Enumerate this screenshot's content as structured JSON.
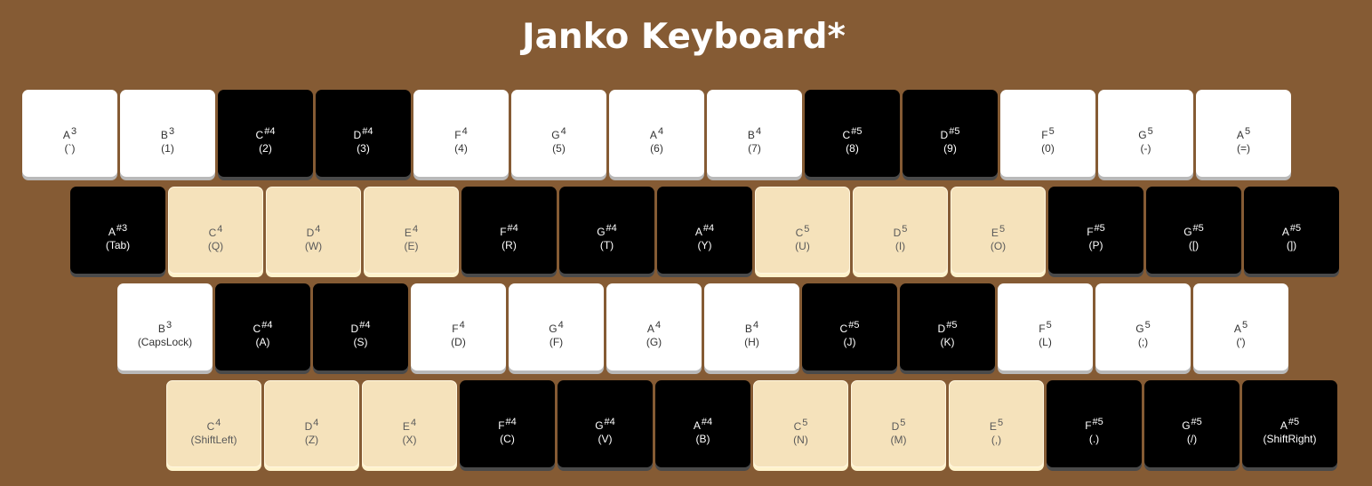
{
  "page": {
    "title": "Janko Keyboard*"
  },
  "colors": {
    "background": "#855b34",
    "white_key": "#ffffff",
    "black_key": "#000000",
    "cream_key": "#f5e2bb"
  },
  "rows": [
    {
      "keys": [
        {
          "note": "A",
          "octave": "3",
          "kb": "(`)",
          "color": "white"
        },
        {
          "note": "B",
          "octave": "3",
          "kb": "(1)",
          "color": "white"
        },
        {
          "note": "C",
          "octave": "#4",
          "kb": "(2)",
          "color": "black"
        },
        {
          "note": "D",
          "octave": "#4",
          "kb": "(3)",
          "color": "black"
        },
        {
          "note": "F",
          "octave": "4",
          "kb": "(4)",
          "color": "white"
        },
        {
          "note": "G",
          "octave": "4",
          "kb": "(5)",
          "color": "white"
        },
        {
          "note": "A",
          "octave": "4",
          "kb": "(6)",
          "color": "white"
        },
        {
          "note": "B",
          "octave": "4",
          "kb": "(7)",
          "color": "white"
        },
        {
          "note": "C",
          "octave": "#5",
          "kb": "(8)",
          "color": "black"
        },
        {
          "note": "D",
          "octave": "#5",
          "kb": "(9)",
          "color": "black"
        },
        {
          "note": "F",
          "octave": "5",
          "kb": "(0)",
          "color": "white"
        },
        {
          "note": "G",
          "octave": "5",
          "kb": "(-)",
          "color": "white"
        },
        {
          "note": "A",
          "octave": "5",
          "kb": "(=)",
          "color": "white"
        }
      ]
    },
    {
      "keys": [
        {
          "note": "A",
          "octave": "#3",
          "kb": "(Tab)",
          "color": "black"
        },
        {
          "note": "C",
          "octave": "4",
          "kb": "(Q)",
          "color": "cream"
        },
        {
          "note": "D",
          "octave": "4",
          "kb": "(W)",
          "color": "cream"
        },
        {
          "note": "E",
          "octave": "4",
          "kb": "(E)",
          "color": "cream"
        },
        {
          "note": "F",
          "octave": "#4",
          "kb": "(R)",
          "color": "black"
        },
        {
          "note": "G",
          "octave": "#4",
          "kb": "(T)",
          "color": "black"
        },
        {
          "note": "A",
          "octave": "#4",
          "kb": "(Y)",
          "color": "black"
        },
        {
          "note": "C",
          "octave": "5",
          "kb": "(U)",
          "color": "cream"
        },
        {
          "note": "D",
          "octave": "5",
          "kb": "(I)",
          "color": "cream"
        },
        {
          "note": "E",
          "octave": "5",
          "kb": "(O)",
          "color": "cream"
        },
        {
          "note": "F",
          "octave": "#5",
          "kb": "(P)",
          "color": "black"
        },
        {
          "note": "G",
          "octave": "#5",
          "kb": "([)",
          "color": "black"
        },
        {
          "note": "A",
          "octave": "#5",
          "kb": "(])",
          "color": "black"
        }
      ]
    },
    {
      "keys": [
        {
          "note": "B",
          "octave": "3",
          "kb": "(CapsLock)",
          "color": "white"
        },
        {
          "note": "C",
          "octave": "#4",
          "kb": "(A)",
          "color": "black"
        },
        {
          "note": "D",
          "octave": "#4",
          "kb": "(S)",
          "color": "black"
        },
        {
          "note": "F",
          "octave": "4",
          "kb": "(D)",
          "color": "white"
        },
        {
          "note": "G",
          "octave": "4",
          "kb": "(F)",
          "color": "white"
        },
        {
          "note": "A",
          "octave": "4",
          "kb": "(G)",
          "color": "white"
        },
        {
          "note": "B",
          "octave": "4",
          "kb": "(H)",
          "color": "white"
        },
        {
          "note": "C",
          "octave": "#5",
          "kb": "(J)",
          "color": "black"
        },
        {
          "note": "D",
          "octave": "#5",
          "kb": "(K)",
          "color": "black"
        },
        {
          "note": "F",
          "octave": "5",
          "kb": "(L)",
          "color": "white"
        },
        {
          "note": "G",
          "octave": "5",
          "kb": "(;)",
          "color": "white"
        },
        {
          "note": "A",
          "octave": "5",
          "kb": "(')",
          "color": "white"
        }
      ]
    },
    {
      "keys": [
        {
          "note": "C",
          "octave": "4",
          "kb": "(ShiftLeft)",
          "color": "cream"
        },
        {
          "note": "D",
          "octave": "4",
          "kb": "(Z)",
          "color": "cream"
        },
        {
          "note": "E",
          "octave": "4",
          "kb": "(X)",
          "color": "cream"
        },
        {
          "note": "F",
          "octave": "#4",
          "kb": "(C)",
          "color": "black"
        },
        {
          "note": "G",
          "octave": "#4",
          "kb": "(V)",
          "color": "black"
        },
        {
          "note": "A",
          "octave": "#4",
          "kb": "(B)",
          "color": "black"
        },
        {
          "note": "C",
          "octave": "5",
          "kb": "(N)",
          "color": "cream"
        },
        {
          "note": "D",
          "octave": "5",
          "kb": "(M)",
          "color": "cream"
        },
        {
          "note": "E",
          "octave": "5",
          "kb": "(,)",
          "color": "cream"
        },
        {
          "note": "F",
          "octave": "#5",
          "kb": "(.)",
          "color": "black"
        },
        {
          "note": "G",
          "octave": "#5",
          "kb": "(/)",
          "color": "black"
        },
        {
          "note": "A",
          "octave": "#5",
          "kb": "(ShiftRight)",
          "color": "black"
        }
      ]
    }
  ]
}
